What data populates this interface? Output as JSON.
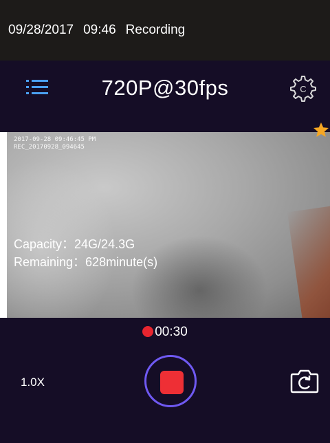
{
  "status_bar": {
    "date": "09/28/2017",
    "time": "09:46",
    "status": "Recording"
  },
  "toolbar": {
    "menu_icon": "list-icon",
    "resolution": "720P@30fps",
    "settings_icon": "gear-icon"
  },
  "preview": {
    "osd_line1": "2017-09-28 09:46:45 PM",
    "osd_line2": "REC_20170928_094645",
    "capacity": "Capacity：24G/24.3G",
    "remaining": "Remaining：628minute(s)",
    "favorite_icon": "star-icon"
  },
  "controls": {
    "timer": "00:30",
    "zoom": "1.0X",
    "record_icon": "stop-icon",
    "snapshot_icon": "camera-icon"
  },
  "colors": {
    "status_bg": "#1d1b19",
    "panel_bg": "#150d26",
    "accent_blue": "#4a9ff0",
    "record_ring": "#6f59f2",
    "record_red": "#ee2f35",
    "star_orange": "#f5a623"
  }
}
